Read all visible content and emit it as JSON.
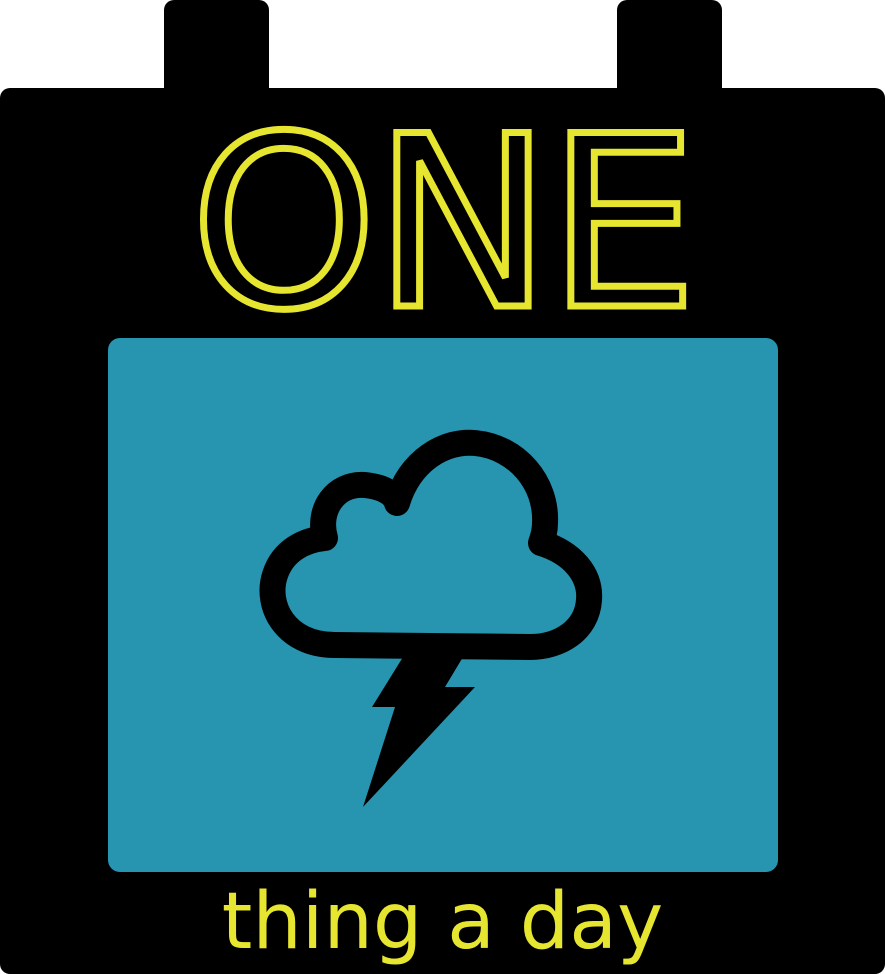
{
  "logo": {
    "title": "ONE",
    "tagline": "thing a day",
    "icon": "storm-cloud-lightning-icon"
  },
  "colors": {
    "frame": "#000000",
    "panel": "#2795b0",
    "text": "#e6e530",
    "background": "#ffffff"
  }
}
